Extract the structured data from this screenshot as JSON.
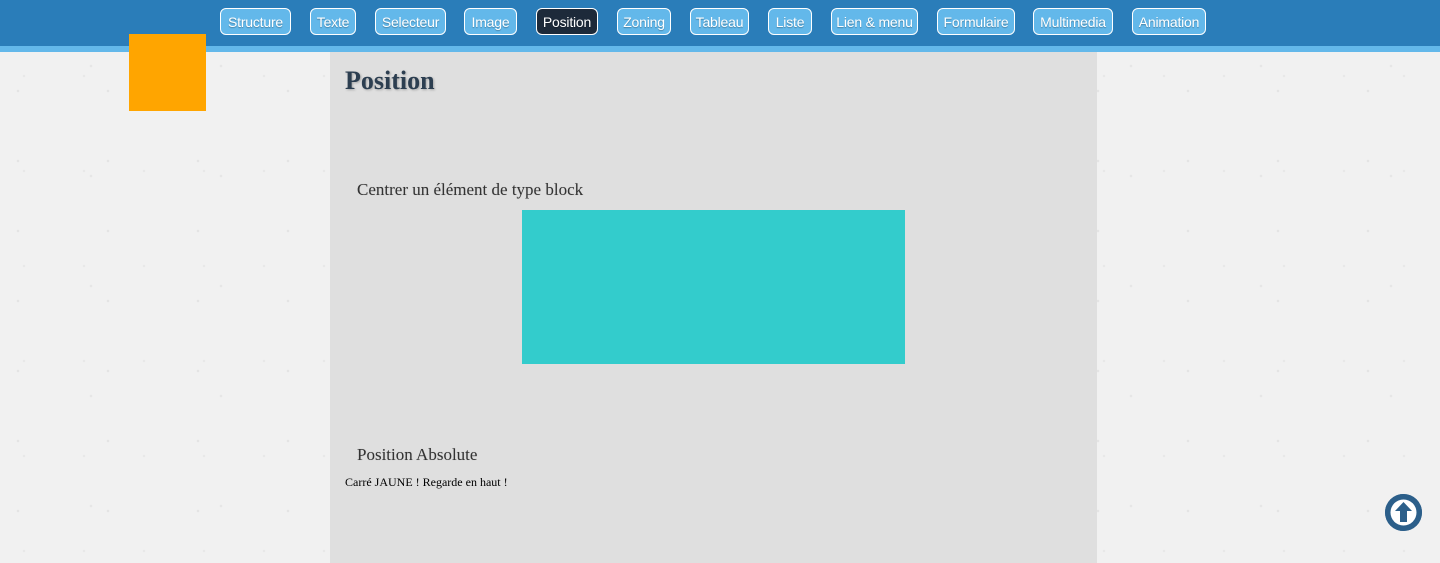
{
  "nav": {
    "items": [
      {
        "label": "Structure",
        "active": false
      },
      {
        "label": "Texte",
        "active": false
      },
      {
        "label": "Selecteur",
        "active": false
      },
      {
        "label": "Image",
        "active": false
      },
      {
        "label": "Position",
        "active": true
      },
      {
        "label": "Zoning",
        "active": false
      },
      {
        "label": "Tableau",
        "active": false
      },
      {
        "label": "Liste",
        "active": false
      },
      {
        "label": "Lien & menu",
        "active": false
      },
      {
        "label": "Formulaire",
        "active": false
      },
      {
        "label": "Multimedia",
        "active": false
      },
      {
        "label": "Animation",
        "active": false
      }
    ]
  },
  "main": {
    "title": "Position",
    "sections": [
      {
        "heading": "Centrer un élément de type block"
      },
      {
        "heading": "Position Absolute",
        "note": "Carré JAUNE ! Regarde en haut !"
      }
    ]
  },
  "colors": {
    "topbar": "#2a7db9",
    "nav_button": "#63b8ea",
    "nav_active": "#1d2a3a",
    "yellow_square": "#ffa500",
    "cyan_block": "#33cccc",
    "content_bg": "#dfdfdf",
    "scroll_button": "#2c5f8a"
  },
  "icons": {
    "scroll_top": "arrow-up-circle-icon"
  }
}
